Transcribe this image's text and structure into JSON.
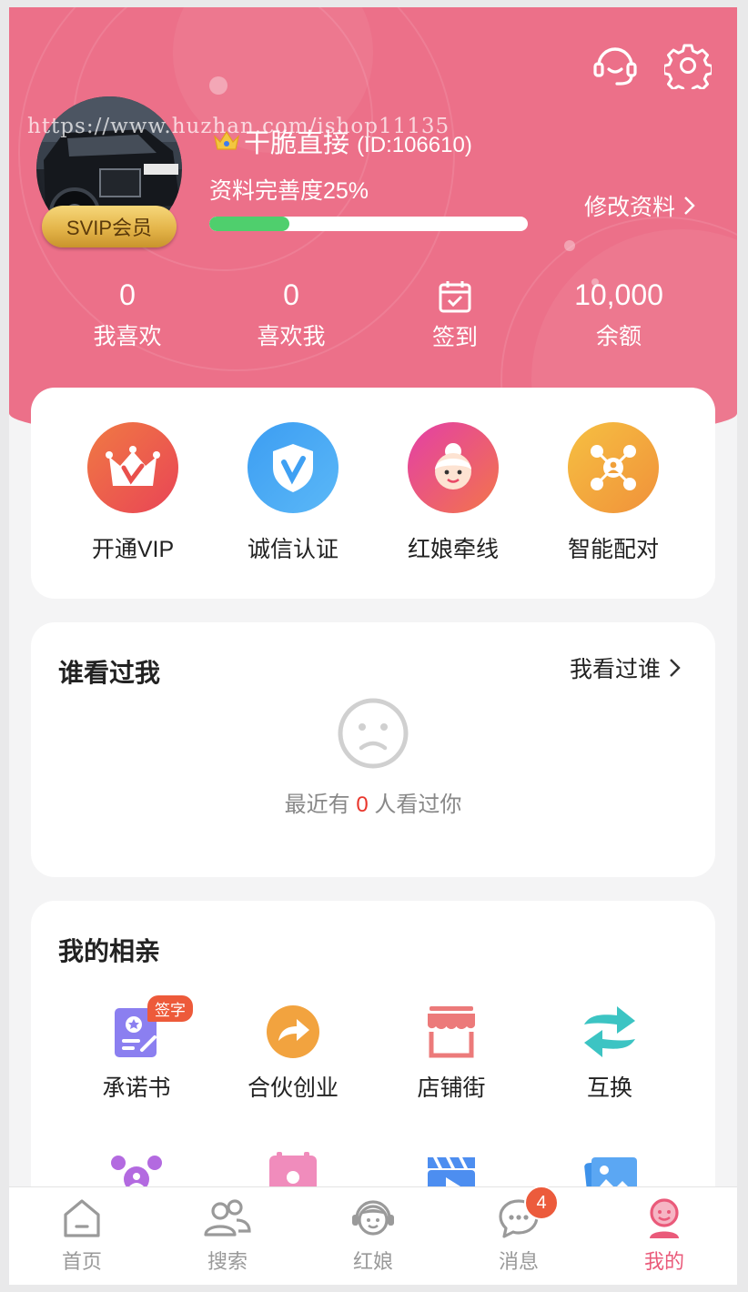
{
  "header": {
    "watermark": "https://www.huzhan.com/ishop11135",
    "username": "干脆直接",
    "user_id": "(ID:106610)",
    "vip_badge": "SVIP会员",
    "profile_completeness": "资料完善度25%",
    "profile_progress_percent": 25,
    "edit_profile_label": "修改资料",
    "icons": {
      "service": "headset-icon",
      "settings": "gear-icon"
    },
    "stats": [
      {
        "value": "0",
        "label": "我喜欢"
      },
      {
        "value": "0",
        "label": "喜欢我"
      },
      {
        "label": "签到",
        "icon": "calendar-check-icon"
      },
      {
        "value": "10,000",
        "label": "余额"
      }
    ]
  },
  "features": [
    {
      "label": "开通VIP",
      "icon": "crown-v-icon",
      "color": "#ec5a45"
    },
    {
      "label": "诚信认证",
      "icon": "shield-v-icon",
      "color": "#3fa0f3"
    },
    {
      "label": "红娘牵线",
      "icon": "matchmaker-icon",
      "color": "#e9478f"
    },
    {
      "label": "智能配对",
      "icon": "network-icon",
      "color": "#f3a533"
    }
  ],
  "visitors": {
    "title": "谁看过我",
    "link_label": "我看过谁",
    "recent_prefix": "最近有",
    "recent_count": "0",
    "recent_suffix": "人看过你"
  },
  "dating": {
    "title": "我的相亲",
    "items": [
      {
        "label": "承诺书",
        "icon": "pledge-icon",
        "badge": "签字"
      },
      {
        "label": "合伙创业",
        "icon": "share-arrow-icon"
      },
      {
        "label": "店铺街",
        "icon": "shop-icon"
      },
      {
        "label": "互换",
        "icon": "swap-icon"
      }
    ],
    "more_icons": [
      "group-icon",
      "calendar-person-icon",
      "video-icon",
      "photo-icon"
    ]
  },
  "tabbar": {
    "items": [
      {
        "label": "首页",
        "icon": "home-icon"
      },
      {
        "label": "搜索",
        "icon": "users-icon"
      },
      {
        "label": "红娘",
        "icon": "matchmaker-headset-icon"
      },
      {
        "label": "消息",
        "icon": "chat-icon",
        "badge": "4"
      },
      {
        "label": "我的",
        "icon": "profile-icon",
        "active": true
      }
    ]
  },
  "colors": {
    "header": "#ec7089",
    "accent": "#ea5a7a",
    "progress": "#4fcf6d"
  }
}
